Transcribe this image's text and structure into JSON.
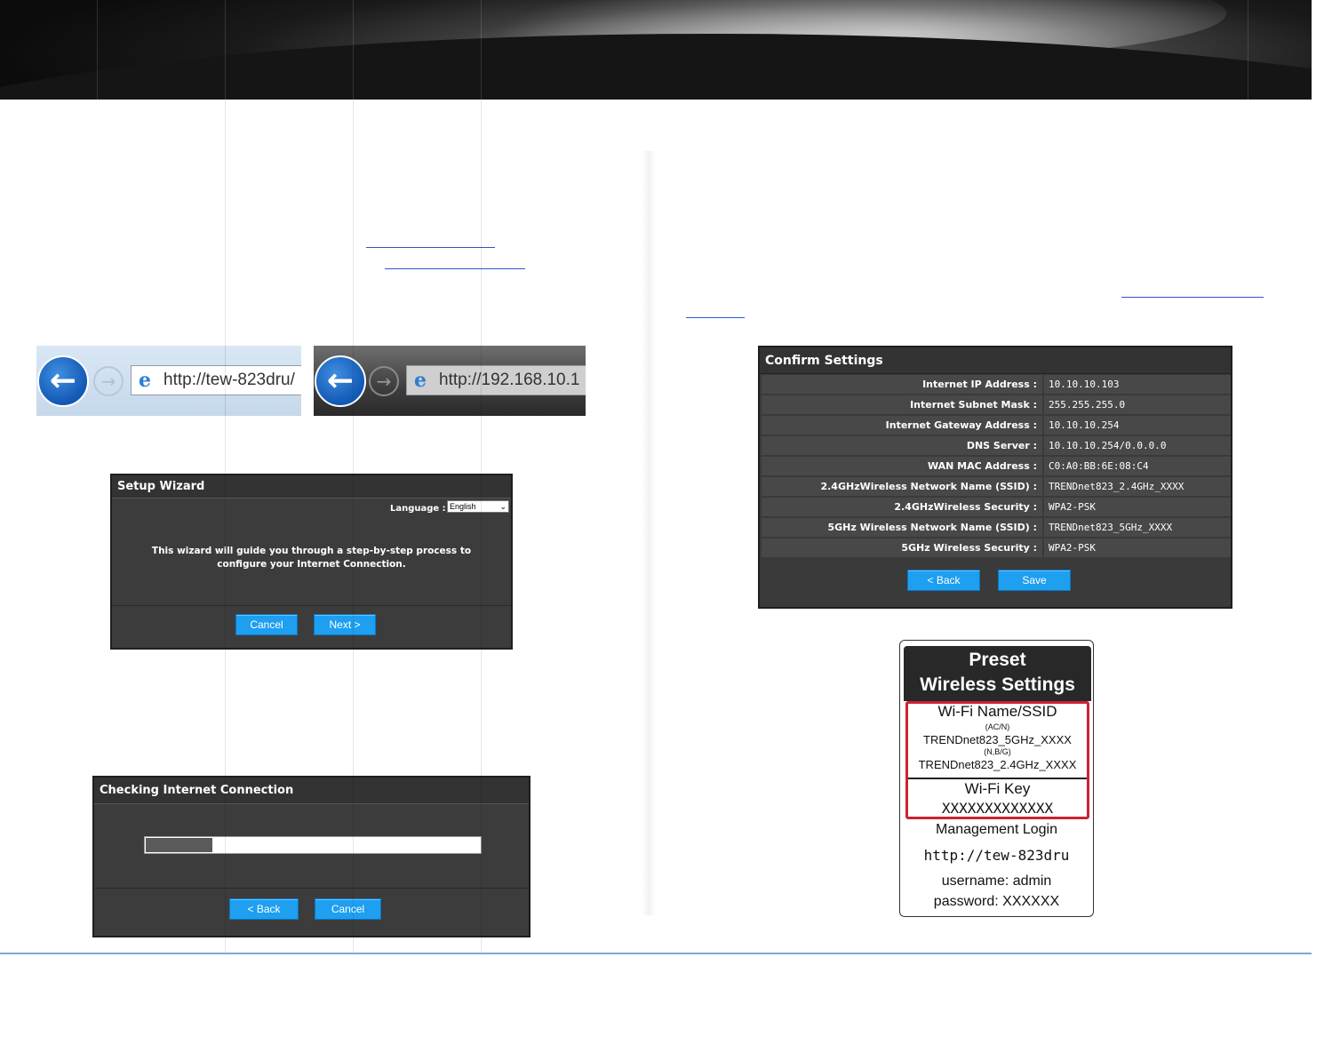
{
  "header": {
    "theme": "dark-gradient-banner",
    "accent_color": "#1e9ff0",
    "rule_color": "#7ea6d6",
    "link_color": "#2a58c8"
  },
  "browser_examples": [
    {
      "url": "http://tew-823dru/",
      "back_icon": "arrow-left-icon",
      "forward_icon": "arrow-right-icon",
      "browser_icon": "ie-icon"
    },
    {
      "url": "http://192.168.10.1",
      "back_icon": "arrow-left-icon",
      "forward_icon": "arrow-right-icon",
      "browser_icon": "ie-icon"
    }
  ],
  "setup_wizard": {
    "title": "Setup Wizard",
    "language_label": "Language :",
    "language_value": "English",
    "description_line1": "This wizard will guide you through a step-by-step process to",
    "description_line2": "configure your Internet Connection.",
    "cancel_label": "Cancel",
    "next_label": "Next >"
  },
  "checking_connection": {
    "title": "Checking Internet Connection",
    "progress": 0.2,
    "back_label": "< Back",
    "cancel_label": "Cancel"
  },
  "confirm_settings": {
    "title": "Confirm Settings",
    "rows": [
      {
        "label": "Internet IP Address :",
        "value": "10.10.10.103"
      },
      {
        "label": "Internet Subnet Mask :",
        "value": "255.255.255.0"
      },
      {
        "label": "Internet Gateway Address :",
        "value": "10.10.10.254"
      },
      {
        "label": "DNS Server :",
        "value": "10.10.10.254/0.0.0.0"
      },
      {
        "label": "WAN MAC Address :",
        "value": "C0:A0:BB:6E:08:C4"
      },
      {
        "label": "2.4GHzWireless Network Name (SSID) :",
        "value": "TRENDnet823_2.4GHz_XXXX"
      },
      {
        "label": "2.4GHzWireless Security :",
        "value": "WPA2-PSK"
      },
      {
        "label": "5GHz Wireless Network Name (SSID) :",
        "value": "TRENDnet823_5GHz_XXXX"
      },
      {
        "label": "5GHz Wireless Security :",
        "value": "WPA2-PSK"
      }
    ],
    "back_label": "< Back",
    "save_label": "Save"
  },
  "sticker": {
    "title_line1": "Preset",
    "title_line2": "Wireless Settings",
    "wifi_name_heading": "Wi-Fi Name/SSID",
    "band_ac": "(AC/N)",
    "ssid_5g": "TRENDnet823_5GHz_XXXX",
    "band_bg": "(N,B/G)",
    "ssid_24g": "TRENDnet823_2.4GHz_XXXX",
    "wifi_key_heading": "Wi-Fi Key",
    "wifi_key": "XXXXXXXXXXXXX",
    "mgmt_heading": "Management Login",
    "mgmt_url": "http://tew-823dru",
    "username": "username: admin",
    "password": "password: XXXXXX"
  }
}
